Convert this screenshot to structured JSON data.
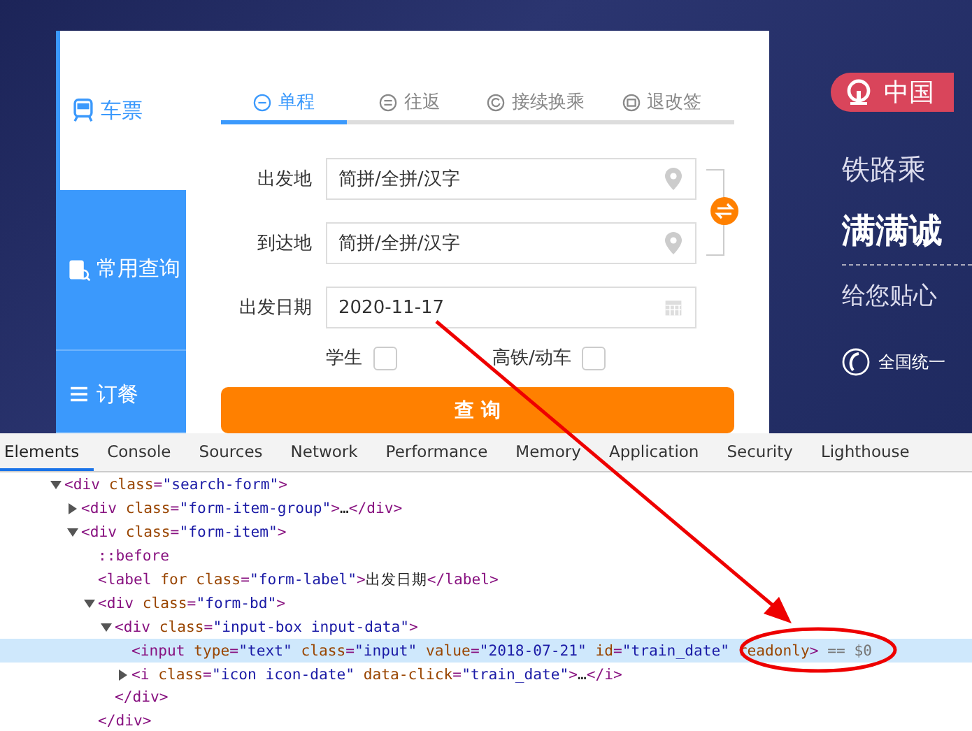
{
  "sidebar": {
    "items": [
      {
        "label": "车票",
        "selected": true
      },
      {
        "label": "常用查询",
        "selected": false
      },
      {
        "label": "订餐",
        "selected": false
      }
    ]
  },
  "tabs": [
    {
      "label": "单程",
      "selected": true
    },
    {
      "label": "往返",
      "selected": false
    },
    {
      "label": "接续换乘",
      "selected": false
    },
    {
      "label": "退改签",
      "selected": false
    }
  ],
  "form": {
    "fields": [
      {
        "label": "出发地",
        "placeholder": "简拼/全拼/汉字"
      },
      {
        "label": "到达地",
        "placeholder": "简拼/全拼/汉字"
      },
      {
        "label": "出发日期",
        "value": "2020-11-17"
      }
    ],
    "checkboxes": [
      {
        "label": "学生",
        "checked": false
      },
      {
        "label": "高铁/动车",
        "checked": false
      }
    ],
    "submit": "查 询"
  },
  "banner": {
    "badge": "中国",
    "lines": [
      "铁路乘",
      "满满诚",
      "给您贴心"
    ],
    "hotline": "全国统一"
  },
  "devtools": {
    "tabs": [
      {
        "label": "Elements",
        "selected": true
      },
      {
        "label": "Console",
        "selected": false
      },
      {
        "label": "Sources",
        "selected": false
      },
      {
        "label": "Network",
        "selected": false
      },
      {
        "label": "Performance",
        "selected": false
      },
      {
        "label": "Memory",
        "selected": false
      },
      {
        "label": "Application",
        "selected": false
      },
      {
        "label": "Security",
        "selected": false
      },
      {
        "label": "Lighthouse",
        "selected": false
      }
    ],
    "tree": [
      {
        "kind": "parent",
        "expanded": true,
        "selected": false,
        "tokens": [
          {
            "kind": "tag",
            "text": "<div"
          },
          {
            "kind": "attr",
            "text": " class"
          },
          {
            "kind": "tag",
            "text": "="
          },
          {
            "kind": "value",
            "text": "\"search-form\""
          },
          {
            "kind": "tag",
            "text": ">"
          }
        ],
        "children": [
          {
            "kind": "parent",
            "expanded": false,
            "selected": false,
            "tokens": [
              {
                "kind": "tag",
                "text": "<div"
              },
              {
                "kind": "attr",
                "text": " class"
              },
              {
                "kind": "tag",
                "text": "="
              },
              {
                "kind": "value",
                "text": "\"form-item-group\""
              },
              {
                "kind": "tag",
                "text": ">"
              },
              {
                "kind": "text",
                "text": "…"
              },
              {
                "kind": "tag",
                "text": "</div>"
              }
            ]
          },
          {
            "kind": "parent",
            "expanded": true,
            "selected": false,
            "tokens": [
              {
                "kind": "tag",
                "text": "<div"
              },
              {
                "kind": "attr",
                "text": " class"
              },
              {
                "kind": "tag",
                "text": "="
              },
              {
                "kind": "value",
                "text": "\"form-item\""
              },
              {
                "kind": "tag",
                "text": ">"
              }
            ],
            "children": [
              {
                "kind": "leaf",
                "selected": false,
                "tokens": [
                  {
                    "kind": "tag",
                    "text": "::before"
                  }
                ]
              },
              {
                "kind": "leaf",
                "selected": false,
                "tokens": [
                  {
                    "kind": "tag",
                    "text": "<label"
                  },
                  {
                    "kind": "attr",
                    "text": " for class"
                  },
                  {
                    "kind": "tag",
                    "text": "="
                  },
                  {
                    "kind": "value",
                    "text": "\"form-label\""
                  },
                  {
                    "kind": "tag",
                    "text": ">"
                  },
                  {
                    "kind": "text",
                    "text": "出发日期"
                  },
                  {
                    "kind": "tag",
                    "text": "</label>"
                  }
                ]
              },
              {
                "kind": "parent",
                "expanded": true,
                "selected": false,
                "tokens": [
                  {
                    "kind": "tag",
                    "text": "<div"
                  },
                  {
                    "kind": "attr",
                    "text": " class"
                  },
                  {
                    "kind": "tag",
                    "text": "="
                  },
                  {
                    "kind": "value",
                    "text": "\"form-bd\""
                  },
                  {
                    "kind": "tag",
                    "text": ">"
                  }
                ],
                "children": [
                  {
                    "kind": "parent",
                    "expanded": true,
                    "selected": false,
                    "tokens": [
                      {
                        "kind": "tag",
                        "text": "<div"
                      },
                      {
                        "kind": "attr",
                        "text": " class"
                      },
                      {
                        "kind": "tag",
                        "text": "="
                      },
                      {
                        "kind": "value",
                        "text": "\"input-box input-data\""
                      },
                      {
                        "kind": "tag",
                        "text": ">"
                      }
                    ],
                    "children": [
                      {
                        "kind": "leaf",
                        "selected": true,
                        "tokens": [
                          {
                            "kind": "tag",
                            "text": "<input"
                          },
                          {
                            "kind": "attr",
                            "text": " type"
                          },
                          {
                            "kind": "tag",
                            "text": "="
                          },
                          {
                            "kind": "value",
                            "text": "\"text\""
                          },
                          {
                            "kind": "attr",
                            "text": " class"
                          },
                          {
                            "kind": "tag",
                            "text": "="
                          },
                          {
                            "kind": "value",
                            "text": "\"input\""
                          },
                          {
                            "kind": "attr",
                            "text": " value"
                          },
                          {
                            "kind": "tag",
                            "text": "="
                          },
                          {
                            "kind": "value",
                            "text": "\"2018-07-21\""
                          },
                          {
                            "kind": "attr",
                            "text": " id"
                          },
                          {
                            "kind": "tag",
                            "text": "="
                          },
                          {
                            "kind": "value",
                            "text": "\"train_date\""
                          },
                          {
                            "kind": "attr",
                            "text": " readonly"
                          },
                          {
                            "kind": "tag",
                            "text": ">"
                          },
                          {
                            "kind": "note",
                            "text": " == $0"
                          }
                        ]
                      },
                      {
                        "kind": "parent",
                        "expanded": false,
                        "selected": false,
                        "tokens": [
                          {
                            "kind": "tag",
                            "text": "<i"
                          },
                          {
                            "kind": "attr",
                            "text": " class"
                          },
                          {
                            "kind": "tag",
                            "text": "="
                          },
                          {
                            "kind": "value",
                            "text": "\"icon icon-date\""
                          },
                          {
                            "kind": "attr",
                            "text": " data-click"
                          },
                          {
                            "kind": "tag",
                            "text": "="
                          },
                          {
                            "kind": "value",
                            "text": "\"train_date\""
                          },
                          {
                            "kind": "tag",
                            "text": ">"
                          },
                          {
                            "kind": "text",
                            "text": "…"
                          },
                          {
                            "kind": "tag",
                            "text": "</i>"
                          }
                        ]
                      }
                    ],
                    "close": [
                      {
                        "kind": "tag",
                        "text": "</div>"
                      }
                    ]
                  }
                ],
                "close": [
                  {
                    "kind": "tag",
                    "text": "</div>"
                  }
                ]
              }
            ]
          }
        ]
      }
    ]
  }
}
